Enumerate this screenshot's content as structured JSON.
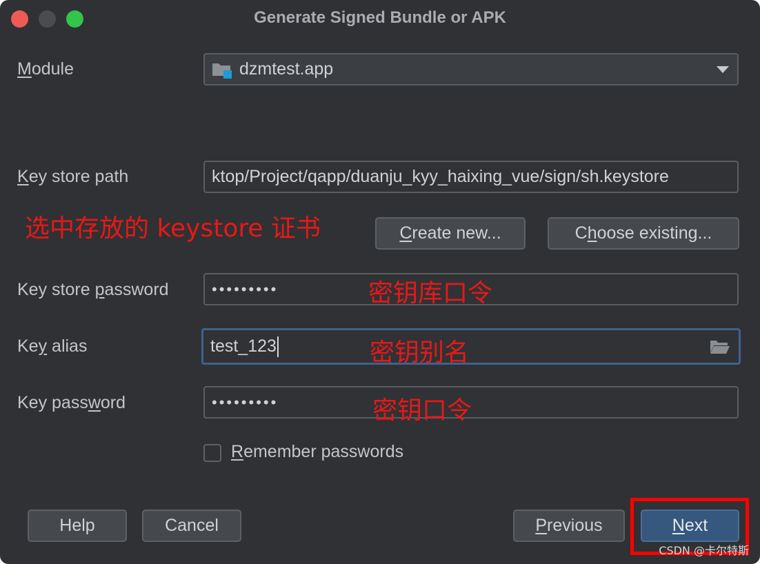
{
  "window": {
    "title": "Generate Signed Bundle or APK"
  },
  "form": {
    "module_label_first": "M",
    "module_label_rest": "odule",
    "module_value": "dzmtest.app",
    "keystore_path_label_first": "K",
    "keystore_path_label_rest": "ey store path",
    "keystore_path_value": "ktop/Project/qapp/duanju_kyy_haixing_vue/sign/sh.keystore",
    "keystore_password_label_pre": "Key store ",
    "keystore_password_label_u": "p",
    "keystore_password_label_post": "assword",
    "keystore_password_value": "•••••••••",
    "key_alias_label_pre": "Ke",
    "key_alias_label_u": "y",
    "key_alias_label_post": " alias",
    "key_alias_value": "test_123",
    "key_password_label_pre": "Key pass",
    "key_password_label_u": "w",
    "key_password_label_post": "ord",
    "key_password_value": "•••••••••",
    "remember_label_first": "R",
    "remember_label_rest": "emember passwords",
    "remember_checked": false
  },
  "buttons": {
    "create_new_first": "C",
    "create_new_rest": "reate new...",
    "choose_existing_pre": "C",
    "choose_existing_u": "h",
    "choose_existing_post": "oose existing...",
    "help": "Help",
    "cancel": "Cancel",
    "previous_first": "P",
    "previous_rest": "revious",
    "next_first": "N",
    "next_rest": "ext"
  },
  "annotations": {
    "keystore_hint": "选中存放的 keystore 证书",
    "keystore_password_hint": "密钥库口令",
    "key_alias_hint": "密钥别名",
    "key_password_hint": "密钥口令"
  },
  "watermark": "CSDN @卡尔特斯",
  "colors": {
    "window_bg": "#2f3134",
    "primary_button": "#36577e",
    "focus_border": "#3d6290",
    "annotation": "#e81818",
    "highlight_box": "#ff0000"
  },
  "icons": {
    "module": "module-folder-icon",
    "dropdown": "chevron-down-icon",
    "folder": "folder-open-icon"
  }
}
